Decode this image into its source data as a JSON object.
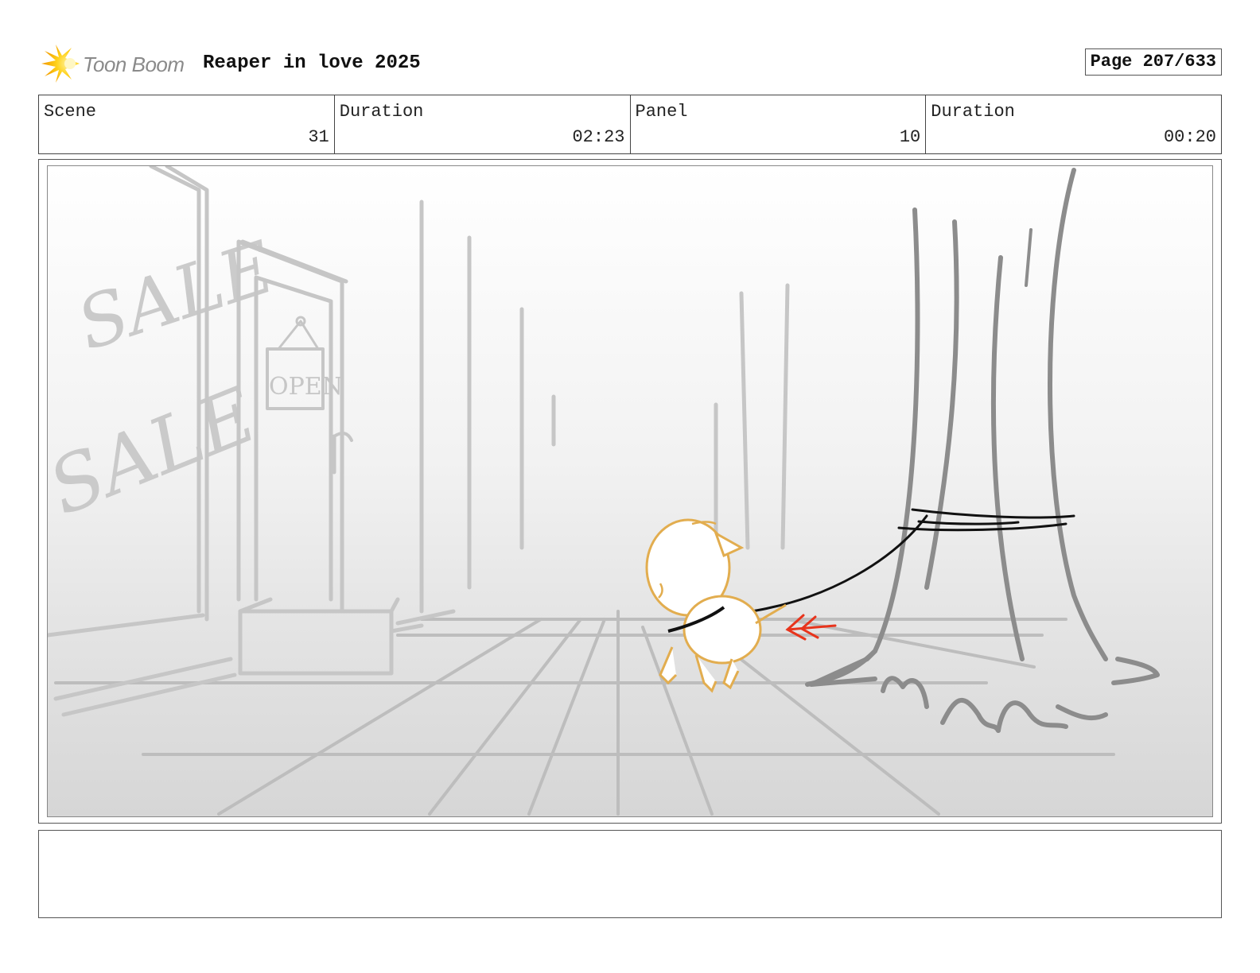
{
  "header": {
    "logo_text": "Toon Boom",
    "logo_icon": "sunburst-logo-icon",
    "title": "Reaper in love 2025",
    "page": "Page 207/633"
  },
  "info": {
    "scene_label": "Scene",
    "scene_value": "31",
    "scene_duration_label": "Duration",
    "scene_duration_value": "02:23",
    "panel_label": "Panel",
    "panel_value": "10",
    "panel_duration_label": "Duration",
    "panel_duration_value": "00:20"
  },
  "panel": {
    "sketch_texts": {
      "sale_sign_1": "SALE",
      "sale_sign_2": "SALE",
      "open_sign": "OPEN"
    },
    "colors": {
      "background_sketch": "#c4c4c4",
      "tree": "#8c8c8c",
      "dog": "#e2ad4f",
      "leash": "#111111",
      "motion_arrow": "#e8341c"
    }
  },
  "notes": {
    "text": ""
  }
}
